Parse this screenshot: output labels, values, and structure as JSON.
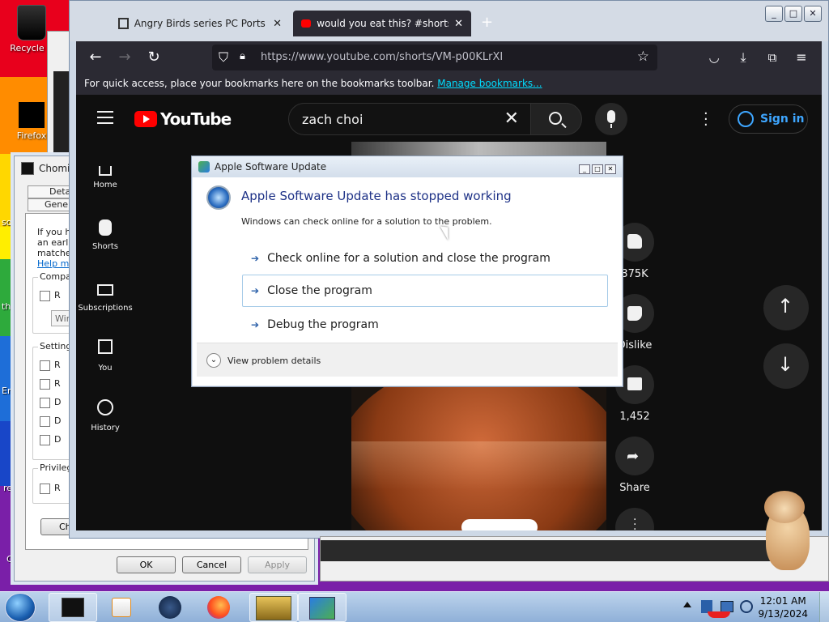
{
  "desktop": {
    "icons": [
      {
        "label": "Recycle Bin",
        "display": "Recycle B"
      },
      {
        "label": "Firefox"
      }
    ],
    "edge_texts": [
      "Fi",
      "so",
      "the",
      "En",
      "re",
      "C"
    ]
  },
  "compat_dialog": {
    "title": "Chomik",
    "tabs": [
      "Deta",
      "Genera"
    ],
    "intro_lines": [
      "If you ha",
      "an earlie",
      "matches"
    ],
    "help_link": "Help m",
    "group_compat": {
      "legend": "Compa",
      "checkbox": "R",
      "select_value": "Win"
    },
    "group_settings": {
      "legend": "Setting",
      "items": [
        "R",
        "R",
        "D",
        "D",
        "D"
      ]
    },
    "group_priv": {
      "legend": "Privileg",
      "items": [
        "R"
      ]
    },
    "change_button": "Cha",
    "ok": "OK",
    "cancel": "Cancel",
    "apply": "Apply"
  },
  "browser": {
    "tabs": [
      {
        "title": "Angry Birds series PC Ports : Ro",
        "active": false
      },
      {
        "title": "would you eat this? #shorts - Y",
        "active": true
      }
    ],
    "new_tab": "+",
    "window_buttons": [
      "_",
      "□",
      "✕"
    ],
    "url": "https://www.youtube.com/shorts/VM-p00KLrXI",
    "bookmarks_message": "For quick access, place your bookmarks here on the bookmarks toolbar.",
    "bookmarks_link": "Manage bookmarks..."
  },
  "youtube": {
    "logo": "YouTube",
    "search_query": "zach choi",
    "sign_in": "Sign in",
    "sidebar": [
      {
        "label": "Home",
        "icon": "home-icon"
      },
      {
        "label": "Shorts",
        "icon": "shorts-icon"
      },
      {
        "label": "Subscriptions",
        "icon": "subscriptions-icon"
      },
      {
        "label": "You",
        "icon": "you-icon"
      },
      {
        "label": "History",
        "icon": "history-icon"
      }
    ],
    "actions": {
      "likes": "375K",
      "dislike": "Dislike",
      "comments": "1,452",
      "share": "Share"
    }
  },
  "error_dialog": {
    "title": "Apple Software Update",
    "heading": "Apple Software Update has stopped working",
    "subtext": "Windows can check online for a solution to the problem.",
    "options": [
      "Check online for a solution and close the program",
      "Close the program",
      "Debug the program"
    ],
    "details": "View problem details"
  },
  "taskbar": {
    "time": "12:01 AM",
    "date": "9/13/2024"
  },
  "colors": {
    "youtube_red": "#ff0000",
    "firefox_dark": "#2b2a33",
    "link_cyan": "#00ddff",
    "dialog_heading_blue": "#1e3287"
  }
}
